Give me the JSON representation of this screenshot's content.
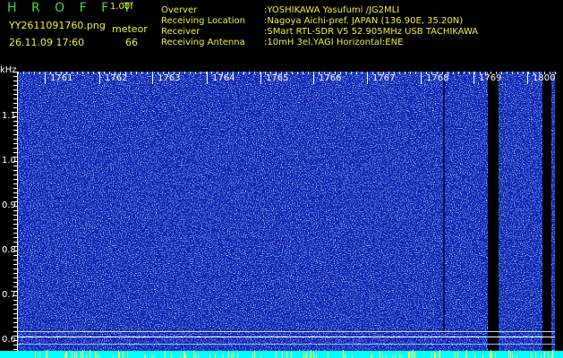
{
  "header": {
    "app_title": "H R O F F T",
    "version": "1.00f",
    "filename": "YY2611091760.png",
    "datetime": "26.11.09 17:60",
    "meteor_label": "meteor",
    "meteor_count": "66"
  },
  "info": [
    {
      "key": "Overver",
      "value": ":YOSHIKAWA Yasufumi /JG2MLI"
    },
    {
      "key": "Receiving Location",
      "value": ":Nagoya Aichi-pref. JAPAN (136.90E, 35.20N)"
    },
    {
      "key": "Receiver",
      "value": ":SMart RTL-SDR V5 52.905MHz USB TACHIKAWA"
    },
    {
      "key": "Receiving Antenna",
      "value": ":10mH 3el.YAGI Horizontal:ENE"
    }
  ],
  "axes": {
    "y_unit": "kHz",
    "y_ticks": [
      "1.1",
      "1.0",
      "0.9",
      "0.8",
      "0.7",
      "0.6"
    ],
    "x_ticks": [
      "1761",
      "1762",
      "1763",
      "1764",
      "1765",
      "1766",
      "1767",
      "1768",
      "1769",
      "1800"
    ]
  },
  "colors": {
    "background": "#000000",
    "noise_base": "#1020b4",
    "noise_bright": "#5ab4ff",
    "noise_hot": "#ffff50",
    "floor": "#00ffff",
    "label_green": "#3ddc3d",
    "label_yellow": "#f0f03c"
  }
}
